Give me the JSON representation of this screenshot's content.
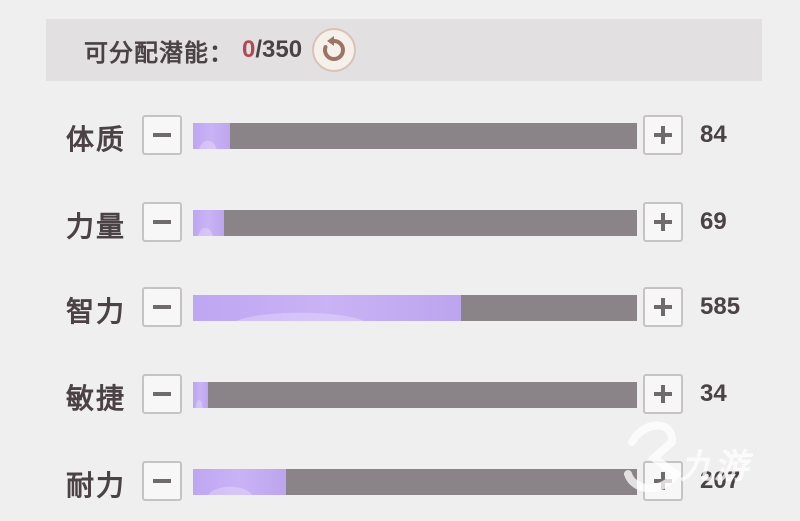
{
  "header": {
    "label": "可分配潜能：",
    "current": "0",
    "separator": "/",
    "total": "350",
    "reset_icon": "reset-arrow-icon"
  },
  "max_bar_value": 1000,
  "stats": [
    {
      "name": "体质",
      "value": "84",
      "fill": 0.084
    },
    {
      "name": "力量",
      "value": "69",
      "fill": 0.069
    },
    {
      "name": "智力",
      "value": "585",
      "fill": 0.603
    },
    {
      "name": "敏捷",
      "value": "34",
      "fill": 0.034
    },
    {
      "name": "耐力",
      "value": "207",
      "fill": 0.21
    }
  ],
  "watermark": {
    "brand": "九游"
  },
  "colors": {
    "background": "#f0efef",
    "header_bg": "#e2e0e1",
    "text": "#4a4244",
    "current_value": "#b04a4f",
    "bar_track": "#8a8489",
    "bar_fill": "#c9b3f5"
  }
}
